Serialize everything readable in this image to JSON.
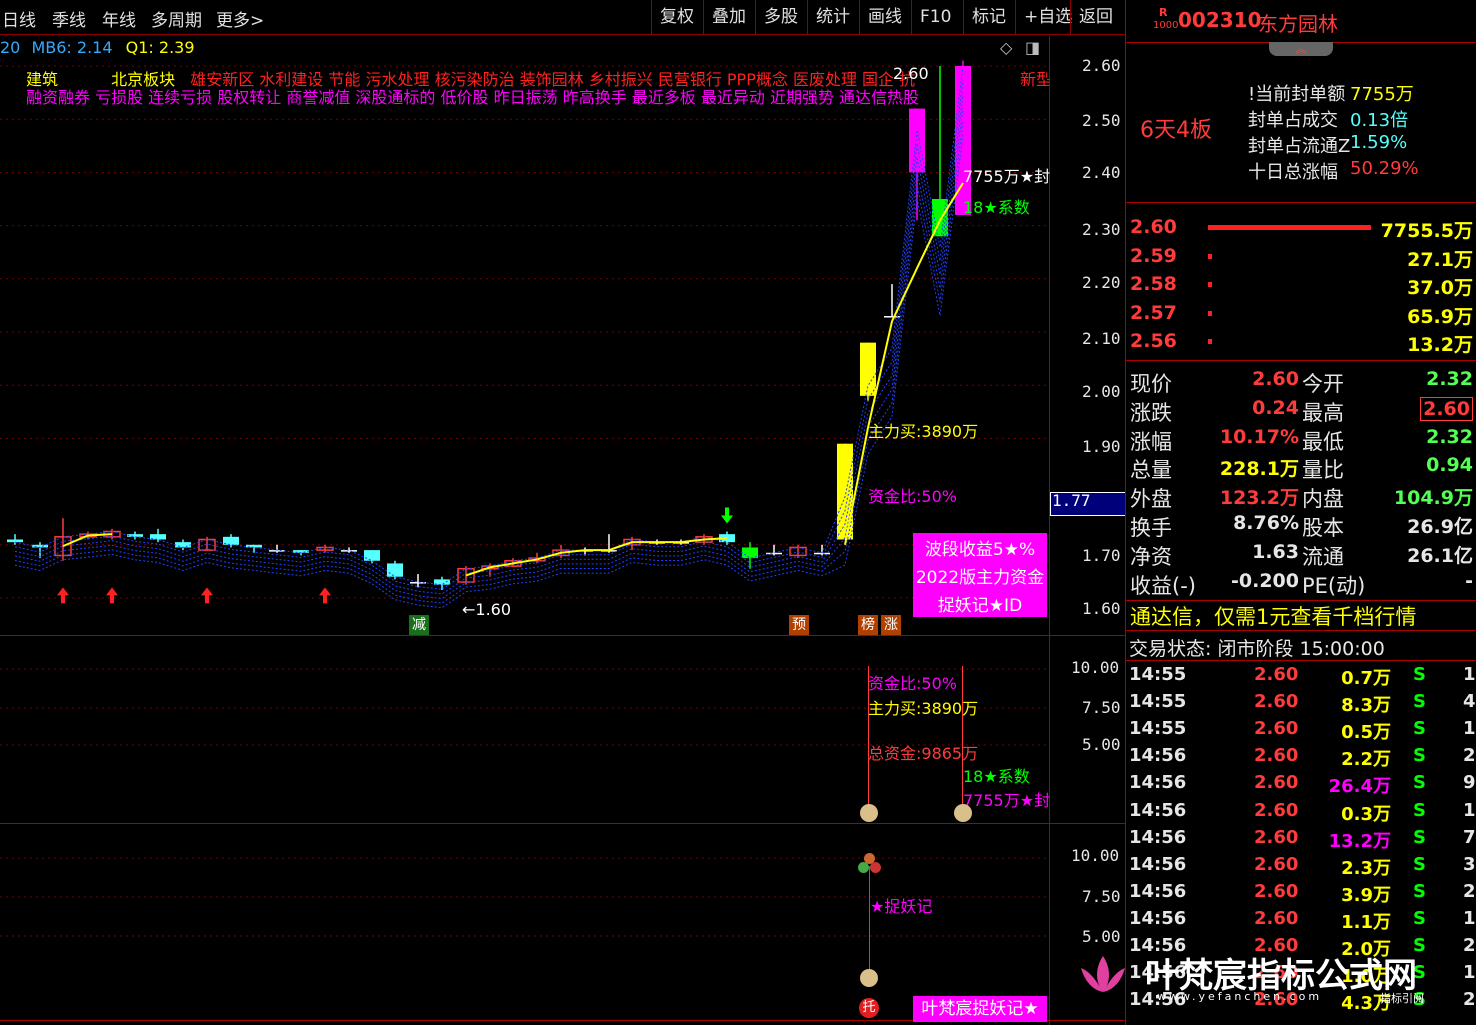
{
  "menu": {
    "left": [
      "日线",
      "季线",
      "年线",
      "多周期",
      "更多>"
    ],
    "right": [
      "复权",
      "叠加",
      "多股",
      "统计",
      "画线",
      "F10",
      "标记",
      "+自选",
      "返回"
    ]
  },
  "indicator_line": {
    "a": "20",
    "mb6_label": "MB6:",
    "mb6_value": "2.14",
    "q1_label": "Q1:",
    "q1_value": "2.39"
  },
  "tags": {
    "row1_yellow": [
      "建筑",
      "北京板块"
    ],
    "row1_red": "雄安新区 水利建设 节能 污水处理 核污染防治 装饰园林 乡村振兴 民营银行 PPP概念 医废处理 国企 抗",
    "row1_extra": "新型",
    "row2_magenta": "融资融券 亏损股 连续亏损 股权转让 商誉减值 深股通标的 低价股 昨日振荡 昨高换手 最近多板 最近异动 近期强势 通达信热股"
  },
  "price_axis": [
    "2.60",
    "2.50",
    "2.40",
    "2.30",
    "2.20",
    "2.10",
    "2.00",
    "1.90",
    "1.77",
    "1.70",
    "1.60"
  ],
  "indicator_axis_1": [
    "10.00",
    "7.50",
    "5.00"
  ],
  "indicator_axis_2": [
    "10.00",
    "7.50",
    "5.00"
  ],
  "chart_annotations": {
    "peak_price": "2.60",
    "low_price": "1.60",
    "seal_amount": "7755万★封",
    "coefficient": "18★系数",
    "main_buy": "主力买:3890万",
    "fund_ratio": "资金比:50%",
    "total_fund": "总资金:9865万",
    "zhuoyao": "★捉妖记",
    "marker_reduce": "减",
    "marker_pre": "预",
    "marker_bang": "榜",
    "marker_zhang": "涨",
    "marker_tuo": "托"
  },
  "promo_box": {
    "line1": "波段收益5★%",
    "line2": "2022版主力资金",
    "line3": "捉妖记★ID"
  },
  "promo_bottom": "叶梵宸捉妖记★",
  "watermark": {
    "title": "叶梵宸指标公式网",
    "url": "www.yefanchen.com",
    "sub": "指标引阅"
  },
  "stock": {
    "tag_r": "R",
    "tag_num": "1000",
    "code": "002310",
    "name": "东方园林"
  },
  "limit_info": {
    "streak": "6天4板",
    "rows": [
      {
        "label": "!当前封单额",
        "value": "7755万"
      },
      {
        "label": "封单占成交",
        "value": "0.13倍"
      },
      {
        "label": "封单占流通Z",
        "value": "1.59%"
      },
      {
        "label": "十日总涨幅",
        "value": "50.29%"
      }
    ]
  },
  "order_book": [
    {
      "price": "2.60",
      "vol": "7755.5万",
      "bar": 1.0
    },
    {
      "price": "2.59",
      "vol": "27.1万",
      "bar": 0.01
    },
    {
      "price": "2.58",
      "vol": "37.0万",
      "bar": 0.01
    },
    {
      "price": "2.57",
      "vol": "65.9万",
      "bar": 0.01
    },
    {
      "price": "2.56",
      "vol": "13.2万",
      "bar": 0.01
    }
  ],
  "quote": [
    {
      "l1": "现价",
      "v1": "2.60",
      "l2": "今开",
      "v2": "2.32"
    },
    {
      "l1": "涨跌",
      "v1": "0.24",
      "l2": "最高",
      "v2": "2.60"
    },
    {
      "l1": "涨幅",
      "v1": "10.17%",
      "l2": "最低",
      "v2": "2.32"
    },
    {
      "l1": "总量",
      "v1": "228.1万",
      "l2": "量比",
      "v2": "0.94"
    },
    {
      "l1": "外盘",
      "v1": "123.2万",
      "l2": "内盘",
      "v2": "104.9万"
    },
    {
      "l1": "换手",
      "v1": "8.76%",
      "l2": "股本",
      "v2": "26.9亿"
    },
    {
      "l1": "净资",
      "v1": "1.63",
      "l2": "流通",
      "v2": "26.1亿"
    },
    {
      "l1": "收益(-)",
      "v1": "-0.200",
      "l2": "PE(动)",
      "v2": "-"
    }
  ],
  "promo_text": "通达信，仅需1元查看千档行情",
  "trade_status": "交易状态: 闭市阶段 15:00:00",
  "ticks": [
    {
      "time": "14:55",
      "price": "2.60",
      "vol": "0.7万",
      "side": "S",
      "n": "1"
    },
    {
      "time": "14:55",
      "price": "2.60",
      "vol": "8.3万",
      "side": "S",
      "n": "4"
    },
    {
      "time": "14:55",
      "price": "2.60",
      "vol": "0.5万",
      "side": "S",
      "n": "1"
    },
    {
      "time": "14:56",
      "price": "2.60",
      "vol": "2.2万",
      "side": "S",
      "n": "2"
    },
    {
      "time": "14:56",
      "price": "2.60",
      "vol": "26.4万",
      "side": "S",
      "n": "9"
    },
    {
      "time": "14:56",
      "price": "2.60",
      "vol": "0.3万",
      "side": "S",
      "n": "1"
    },
    {
      "time": "14:56",
      "price": "2.60",
      "vol": "13.2万",
      "side": "S",
      "n": "7"
    },
    {
      "time": "14:56",
      "price": "2.60",
      "vol": "2.3万",
      "side": "S",
      "n": "3"
    },
    {
      "time": "14:56",
      "price": "2.60",
      "vol": "3.9万",
      "side": "S",
      "n": "2"
    },
    {
      "time": "14:56",
      "price": "2.60",
      "vol": "1.1万",
      "side": "S",
      "n": "1"
    },
    {
      "time": "14:56",
      "price": "2.60",
      "vol": "2.0万",
      "side": "S",
      "n": "2"
    },
    {
      "time": "14:56",
      "price": "2.60",
      "vol": "1.0万",
      "side": "S",
      "n": "1"
    },
    {
      "time": "14:56",
      "price": "2.60",
      "vol": "4.3万",
      "side": "S",
      "n": "2"
    }
  ],
  "colors": {
    "up": "#ff3b3b",
    "down": "#54ffff",
    "limit": "#ffff00",
    "magenta": "#ff00ff",
    "green": "#00ff00",
    "grid": "#a00000"
  }
}
